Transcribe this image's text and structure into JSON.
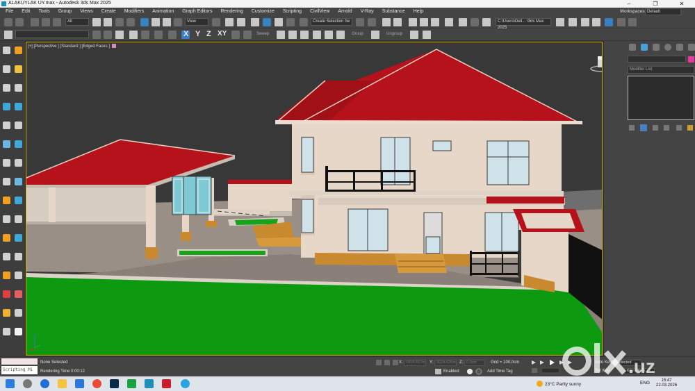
{
  "window": {
    "title": "ALAKUYLAK UY.max - Autodesk 3ds Max 2025",
    "controls": [
      "–",
      "❐",
      "✕"
    ]
  },
  "menu": {
    "items": [
      "File",
      "Edit",
      "Tools",
      "Group",
      "Views",
      "Create",
      "Modifiers",
      "Animation",
      "Graph Editors",
      "Rendering",
      "Customize",
      "Scripting",
      "CivilView",
      "Arnold",
      "V-Ray",
      "Substance",
      "Help"
    ],
    "workspaces_label": "Workspaces:",
    "workspace_value": "Default"
  },
  "toolbar": {
    "selection_filter": "All",
    "ref_coord": "View",
    "named_selection": "Create Selection Se",
    "project_path": "C:\\Users\\Dell... \\3ds Max 2025",
    "axis_x": "X",
    "axis_y": "Y",
    "axis_z": "Z",
    "axis_xy": "XY",
    "sweep_label": "Sweep",
    "group_label": "Group",
    "ungroup_label": "Ungroup"
  },
  "viewport": {
    "label": "[+] [Perspective ] [Standard ] [Edged Faces ]"
  },
  "command_panel": {
    "modifier_list": "Modifier List"
  },
  "status": {
    "script_label": "Scripting Mi",
    "selection": "None Selected",
    "render_time": "Rendering Time  0:00:12",
    "x_label": "X:",
    "x_value": "1818,667m",
    "y_label": "Y:",
    "y_value": "3024,626m",
    "z_label": "Z:",
    "z_value": "0,0cm",
    "grid": "Grid = 100,0cm",
    "enabled_label": "Enabled:",
    "add_time_tag": "Add Time Tag",
    "auto_key": "Auto Key",
    "selected": "Selected",
    "set_key": "Set Key",
    "key_filters": "Key Filters..."
  },
  "watermark": {
    "brand": "olx",
    "suffix": ".uz"
  },
  "taskbar": {
    "weather": "23°C  Partly sunny",
    "language": "ENG",
    "time": "15:47",
    "date": "22.03.2026"
  },
  "colors": {
    "roof": "#b5121b",
    "wall": "#e6d7c8",
    "grass": "#109a10",
    "wood": "#c9892e",
    "viewport_border": "#d8b200"
  }
}
